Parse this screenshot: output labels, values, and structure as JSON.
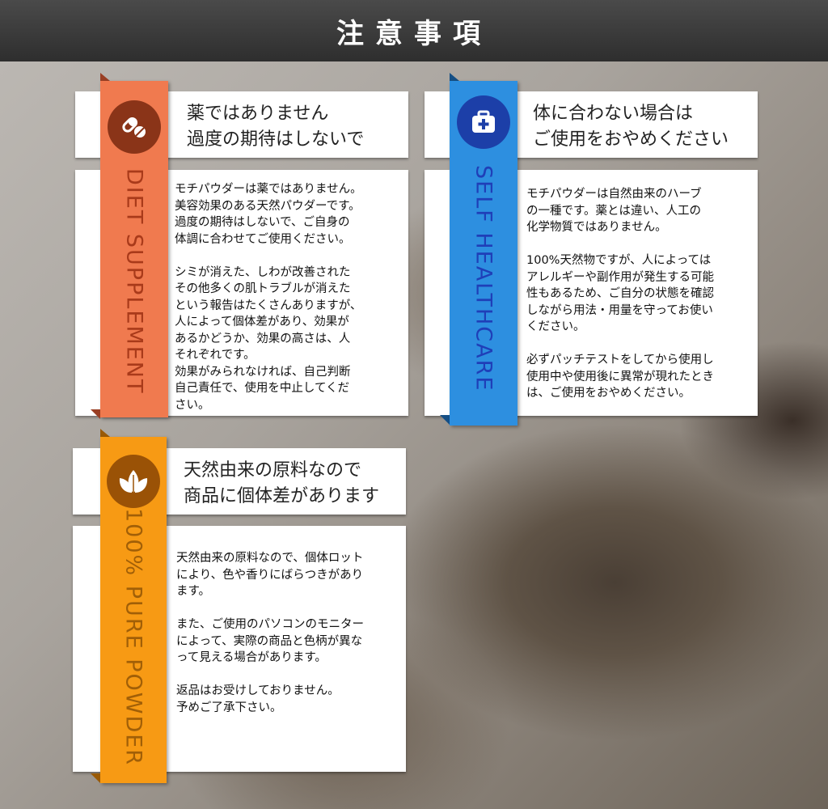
{
  "header": {
    "title": "注意事項"
  },
  "cards": [
    {
      "ribbon_label": "DIET SUPPLEMENT",
      "icon": "pill-icon",
      "color": "#f07a4f",
      "title": "薬ではありません\n過度の期待はしないで",
      "body": "モチパウダーは薬ではありません。\n美容効果のある天然パウダーです。\n過度の期待はしないで、ご自身の\n体調に合わせてご使用ください。\n\nシミが消えた、しわが改善された\nその他多くの肌トラブルが消えた\nという報告はたくさんありますが、\n人によって個体差があり、効果が\nあるかどうか、効果の高さは、人\nそれぞれです。\n効果がみられなければ、自己判断\n自己責任で、使用を中止してくだ\nさい。"
    },
    {
      "ribbon_label": "SELF HEALTHCARE",
      "icon": "medical-kit-icon",
      "color": "#2d8fe0",
      "title": "体に合わない場合は\nご使用をおやめください",
      "body": "モチパウダーは自然由来のハーブ\nの一種です。薬とは違い、人工の\n化学物質ではありません。\n\n100%天然物ですが、人によっては\nアレルギーや副作用が発生する可能\n性もあるため、ご自分の状態を確認\nしながら用法・用量を守ってお使い\nください。\n\n必ずパッチテストをしてから使用し\n使用中や使用後に異常が現れたとき\nは、ご使用をおやめください。"
    },
    {
      "ribbon_label": "100% PURE POWDER",
      "icon": "leaf-icon",
      "color": "#f79a14",
      "title": "天然由来の原料なので\n商品に個体差があります",
      "body": "天然由来の原料なので、個体ロット\nにより、色や香りにばらつきがあり\nます。\n\nまた、ご使用のパソコンのモニター\nによって、実際の商品と色柄が異な\nって見える場合があります。\n\n返品はお受けしておりません。\n予めご了承下さい。"
    }
  ]
}
